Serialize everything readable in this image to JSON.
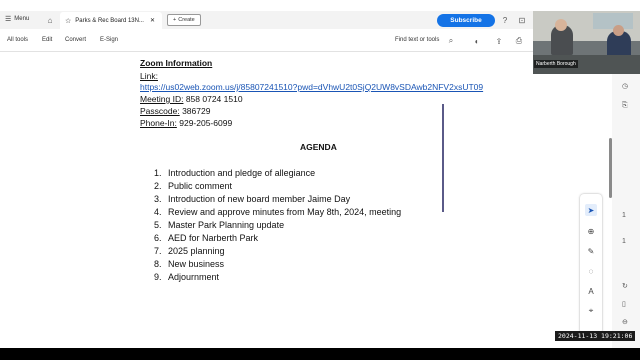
{
  "tabbar": {
    "menu_label": "Menu",
    "tab_title": "Parks & Rec Board 13N...",
    "create_label": "Create",
    "subscribe_label": "Subscribe"
  },
  "toolbar": {
    "items": [
      "All tools",
      "Edit",
      "Convert",
      "E-Sign"
    ],
    "find_label": "Find text or tools"
  },
  "document": {
    "zoom_heading": "Zoom Information",
    "link_label": "Link:",
    "link_url": "https://us02web.zoom.us/j/85807241510?pwd=dVhwU2t0SjQ2UW8vSDAwb2NFV2xsUT09",
    "meeting_id_label": "Meeting ID:",
    "meeting_id_value": " 858 0724 1510",
    "passcode_label": "Passcode:",
    "passcode_value": " 386729",
    "phone_label": "Phone-In:",
    "phone_value": " 929-205-6099",
    "agenda_title": "AGENDA",
    "agenda": [
      {
        "num": "1.",
        "text": "Introduction and pledge of allegiance"
      },
      {
        "num": "2.",
        "text": "Public comment"
      },
      {
        "num": "3.",
        "text": "Introduction of new board member Jaime Day"
      },
      {
        "num": "4.",
        "text": "Review and approve minutes from May 8th, 2024, meeting"
      },
      {
        "num": "5.",
        "text": "Master Park Planning update"
      },
      {
        "num": "6.",
        "text": "AED for Narberth Park"
      },
      {
        "num": "7.",
        "text": "2025 planning"
      },
      {
        "num": "8.",
        "text": "New business"
      },
      {
        "num": "9.",
        "text": "Adjournment"
      }
    ]
  },
  "sidecol": {
    "page_num": "1",
    "page_total": "1"
  },
  "video": {
    "label": "Narberth Borough"
  },
  "timestamp": "2024-11-13  19:21:06",
  "colors": {
    "accent": "#1473e6",
    "link": "#1a55b5"
  }
}
